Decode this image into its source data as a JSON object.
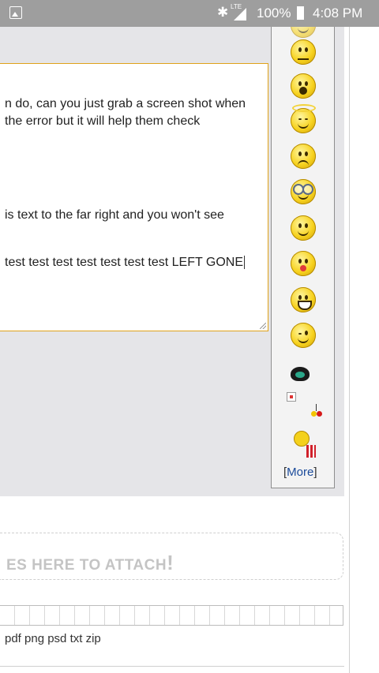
{
  "status_bar": {
    "battery": "100%",
    "network": "LTE",
    "time": "4:08 PM"
  },
  "editor": {
    "lines": [
      "n do, can you just grab a screen shot when",
      "the error but it will help them check",
      "is text to the far right and you won't see",
      "test test test test test test test LEFT GONE"
    ]
  },
  "smileys": {
    "items": [
      "neutral-icon",
      "surprised-icon",
      "angel-icon",
      "sad-icon",
      "glasses-icon",
      "smile-icon",
      "kiss-icon",
      "grin-icon",
      "wink-icon",
      "whistle-icon",
      "broken-image-icon",
      "cherry-icon",
      "popcorn-icon"
    ],
    "more_label": "More"
  },
  "attachments": {
    "drop_text": "ES HERE TO ATTACH",
    "drop_accent": "!",
    "allowed_types": "pdf png psd txt zip"
  },
  "colors": {
    "status_bar": "#9e9e9e",
    "textarea_border": "#e0a21a",
    "link": "#1a4a9a"
  }
}
